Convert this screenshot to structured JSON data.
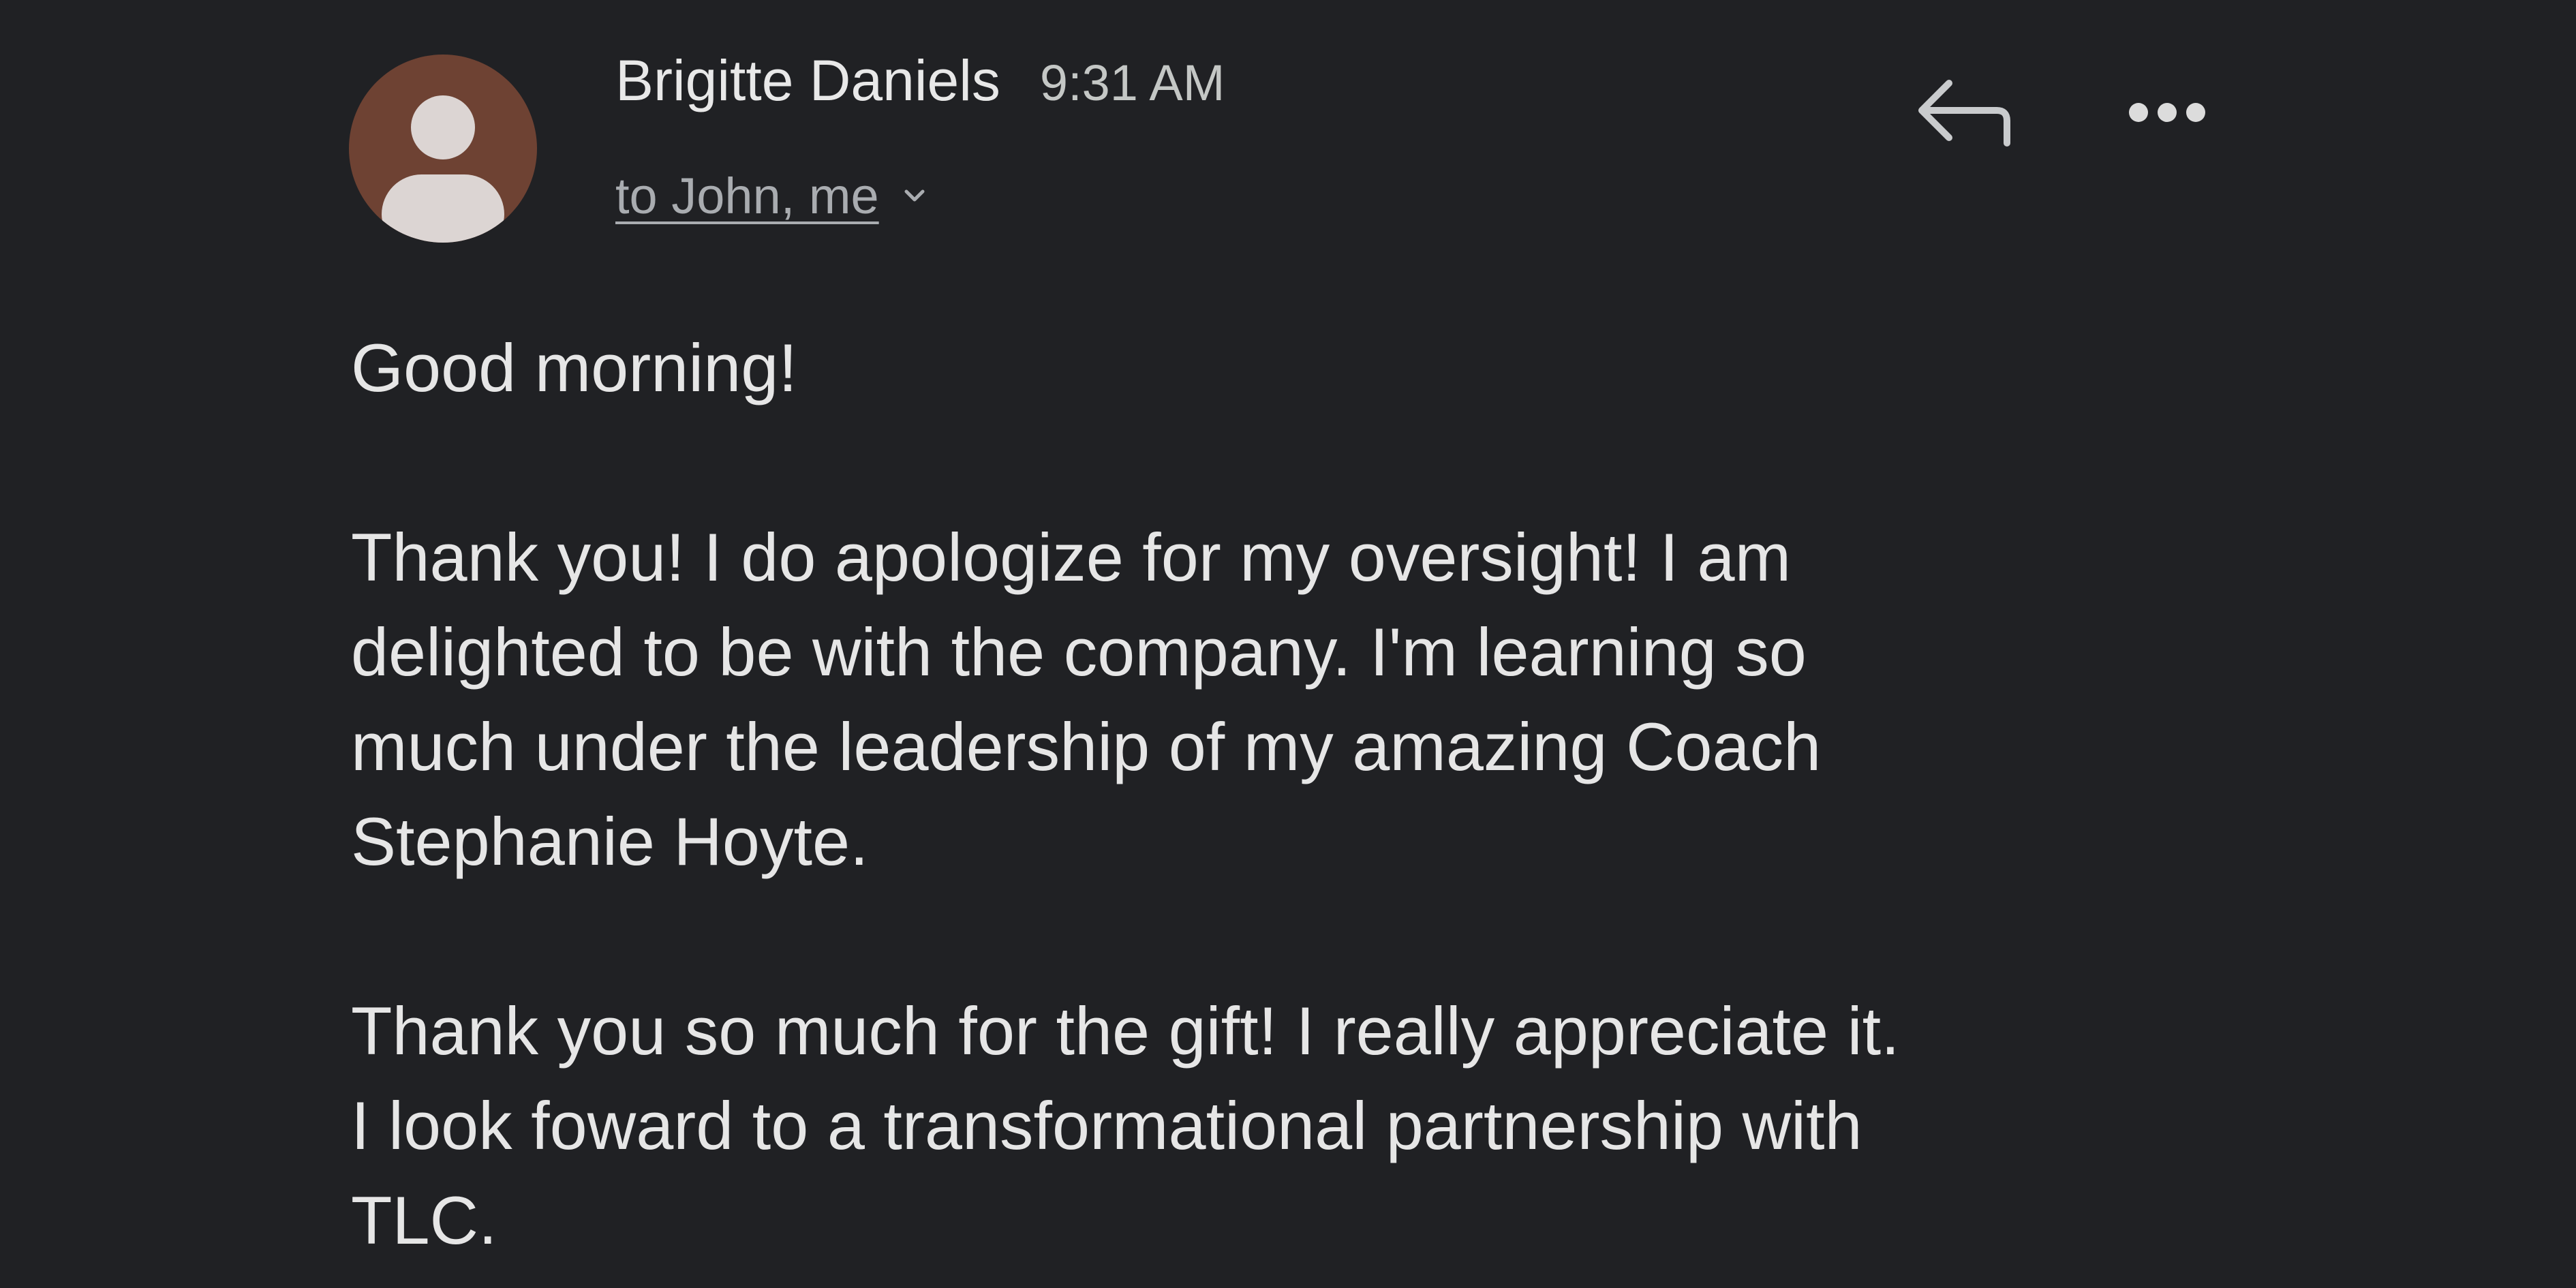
{
  "email": {
    "sender": {
      "name": "Brigitte Daniels",
      "avatar_icon": "person-icon",
      "avatar_color": "#6e4233"
    },
    "timestamp": "9:31 AM",
    "recipients_label": "to John, me",
    "actions": {
      "reply_icon": "reply-icon",
      "more_icon": "more-horizontal-icon"
    },
    "body": {
      "greeting": "Good morning!",
      "paragraph1": [
        "Thank you! I do apologize for my oversight! I am",
        "delighted to be with the company. I'm learning so",
        "much under the leadership of my amazing Coach",
        "Stephanie Hoyte."
      ],
      "paragraph2": [
        "Thank you so much for the gift! I really appreciate it.",
        "I look foward to a transformational partnership with",
        "TLC."
      ]
    }
  },
  "colors": {
    "background": "#202124",
    "text": "#e6e6e6",
    "muted_text": "#a9acb0"
  }
}
